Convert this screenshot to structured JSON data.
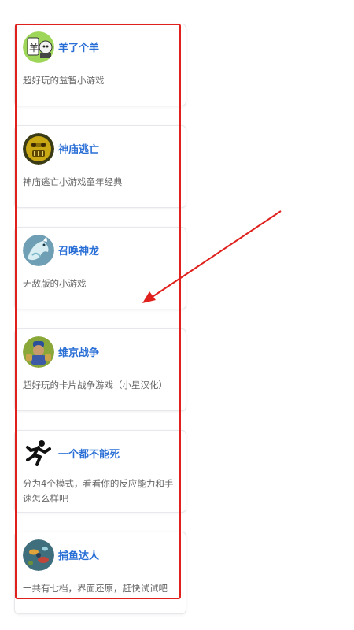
{
  "accent_color": "#2a6fd6",
  "highlight_color": "#e0201c",
  "games": [
    {
      "title": "羊了个羊",
      "desc": "超好玩的益智小游戏",
      "icon": "sheep-game-icon"
    },
    {
      "title": "神庙逃亡",
      "desc": "神庙逃亡小游戏童年经典",
      "icon": "temple-run-icon"
    },
    {
      "title": "召唤神龙",
      "desc": "无敌版的小游戏",
      "icon": "dragon-game-icon"
    },
    {
      "title": "维京战争",
      "desc": "超好玩的卡片战争游戏（小星汉化）",
      "icon": "viking-war-icon"
    },
    {
      "title": "一个都不能死",
      "desc": "分为4个模式，看看你的反应能力和手速怎么样吧",
      "icon": "running-man-icon"
    },
    {
      "title": "捕鱼达人",
      "desc": "一共有七档，界面还原，赶快试试吧",
      "icon": "fishing-game-icon"
    }
  ]
}
